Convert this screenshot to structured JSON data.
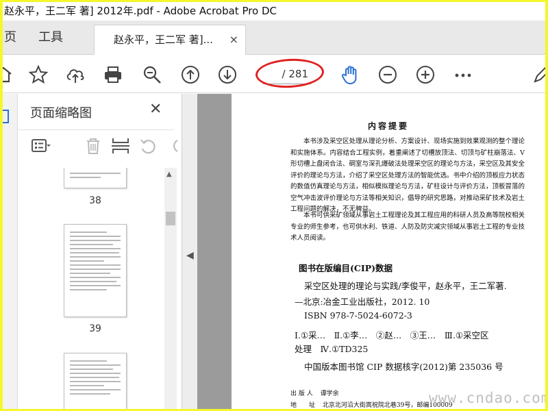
{
  "window": {
    "title": "赵永平，王二军 著] 2012年.pdf - Adobe Acrobat Pro DC"
  },
  "tabs": {
    "home": "页",
    "tools": "工具",
    "document": "赵永平，王二军 著]...",
    "close_symbol": "×"
  },
  "toolbar": {
    "page_total": "/ 281",
    "icons": [
      "home-icon",
      "bookmark-star-icon",
      "upload-cloud-icon",
      "print-icon",
      "zoom-magnifier-icon",
      "page-up-icon",
      "page-down-icon",
      "hand-tool-icon",
      "zoom-out-icon",
      "zoom-in-icon",
      "more-icon",
      "edit-pen-icon"
    ],
    "highlight_color": "#e02020",
    "hand_color": "#2a6fd6"
  },
  "thumbnails_panel": {
    "title": "页面缩略图",
    "close_symbol": "✕",
    "pages": [
      {
        "number": "38"
      },
      {
        "number": "39"
      },
      {
        "number": ""
      }
    ]
  },
  "document": {
    "heading": "内容提要",
    "paragraph1": "本书涉及采空区处理从理论分析、方案设计、现场实施到效果观测的整个理论和实施体系。内容结合工程实例，着重阐述了切槽放顶法、切顶与矿柱崩落法、V形切槽上盘闭合法、硐室与深孔爆破法处理采空区的理论与方法，采空区及其安全评价的理论与方法，介绍了采空区处理方法的智能优选。书中介绍的顶板应力状态的数值仿真理论与方法，相似模拟理论与方法，矿柱设计与评价方法，顶板冒落的空气冲击波评价理论与方法等相关知识，倡导的研究思路，对推动采矿技术及岩土工程问题的解决，不无稗益。",
    "paragraph2": "本书可供采矿领域从事岩土工程理论及其工程应用的科研人员及高等院校相关专业的师生参考，也可供水利、铁道、人防及防灾减灾领域从事岩土工程的专业技术人员阅读。",
    "cip_title": "图书在版编目(CIP)数据",
    "cip_lines": [
      "采空区处理的理论与实践/李俊平，赵永平，王二军著.",
      "—北京:冶金工业出版社，2012. 10",
      "ISBN 978-7-5024-6072-3",
      "Ⅰ.①采…　Ⅱ.①李…　②赵…　③王…　Ⅲ.①采空区",
      "处理　Ⅳ.①TD325",
      "中国版本图书馆 CIP 数据核字(2012)第 235036 号"
    ],
    "publisher_label": "出 版 人",
    "publisher_name": "谭学余",
    "address_label": "地　　址",
    "address_value": "北京北河沿大街嵩祝院北巷39号，邮编100009"
  },
  "watermark": "www.cndao.com"
}
